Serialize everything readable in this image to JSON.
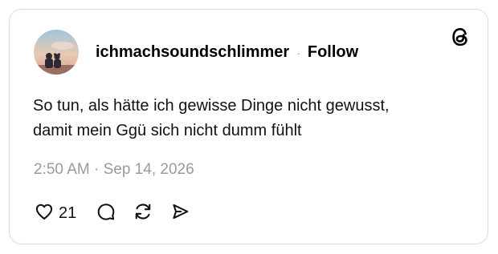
{
  "post": {
    "username": "ichmachsoundschlimmer",
    "separator": "·",
    "follow_label": "Follow",
    "text_lines": [
      "So tun, als hätte ich gewisse Dinge nicht gewusst,",
      "damit mein Ggü sich nicht dumm fühlt"
    ],
    "timestamp": "2:50 AM · Sep 14, 2026",
    "like_count": "21"
  },
  "icons": {
    "brand": "threads-logo-icon",
    "like": "heart-icon",
    "reply": "comment-icon",
    "repost": "repost-icon",
    "share": "send-icon"
  },
  "colors": {
    "text": "#111111",
    "muted": "#9a9a9a",
    "border": "#dcdcdc"
  }
}
